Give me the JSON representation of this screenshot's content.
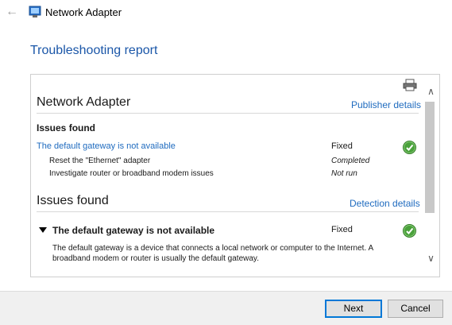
{
  "window": {
    "title": "Network Adapter"
  },
  "page": {
    "heading": "Troubleshooting report"
  },
  "report": {
    "section1": {
      "title": "Network Adapter",
      "link": "Publisher details",
      "issues_heading": "Issues found",
      "issue": {
        "label": "The default gateway is not available",
        "status": "Fixed"
      },
      "steps": [
        {
          "label": "Reset the \"Ethernet\" adapter",
          "status": "Completed"
        },
        {
          "label": "Investigate router or broadband modem issues",
          "status": "Not run"
        }
      ]
    },
    "section2": {
      "title": "Issues found",
      "link": "Detection details",
      "issue": {
        "title": "The default gateway is not available",
        "status": "Fixed",
        "description": "The default gateway is a device that connects a local network or computer to the Internet. A broadband modem or router is usually the default gateway."
      }
    }
  },
  "buttons": {
    "next": "Next",
    "cancel": "Cancel"
  },
  "colors": {
    "accent": "#1a56a8",
    "link": "#1f6bbf",
    "success": "#4aa13b",
    "focus": "#0078d7"
  },
  "icons": [
    "back-arrow-icon",
    "network-adapter-icon",
    "printer-icon",
    "check-icon",
    "expand-triangle-icon",
    "scroll-up-icon",
    "scroll-down-icon"
  ]
}
